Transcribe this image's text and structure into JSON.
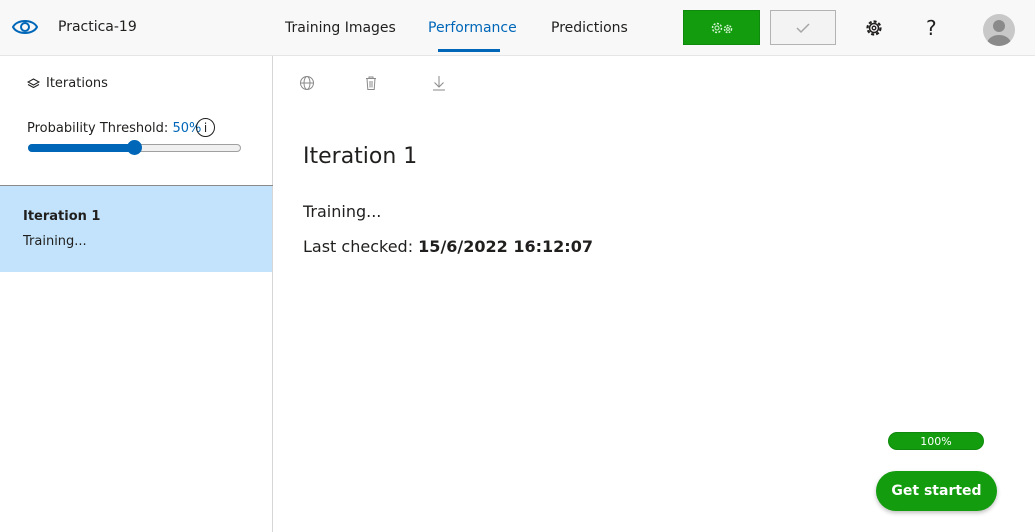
{
  "header": {
    "project_name": "Practica-19",
    "tabs": [
      {
        "label": "Training Images"
      },
      {
        "label": "Performance"
      },
      {
        "label": "Predictions"
      }
    ],
    "active_tab": "Performance",
    "help_label": "?"
  },
  "sidebar": {
    "iterations_heading": "Iterations",
    "threshold_label": "Probability Threshold:",
    "threshold_value": "50%",
    "threshold_fraction": 0.5,
    "info_label": "i",
    "iterations": [
      {
        "title": "Iteration 1",
        "status": "Training..."
      }
    ]
  },
  "main": {
    "title": "Iteration 1",
    "status": "Training...",
    "last_checked_label": "Last checked:",
    "last_checked_value": "15/6/2022 16:12:07"
  },
  "footer": {
    "progress_text": "100%",
    "progress_fraction": 1.0,
    "get_started_label": "Get started"
  },
  "icons": {
    "logo": "eye-icon",
    "train": "gears-icon",
    "quick_test": "check-icon",
    "settings": "gear-icon",
    "avatar": "user-icon",
    "iterations": "layers-icon",
    "publish": "globe-icon",
    "delete": "trash-icon",
    "export": "download-icon"
  },
  "colors": {
    "accent": "#0067b8",
    "train_green": "#129c0e",
    "selected_row": "#c2e3fb"
  }
}
